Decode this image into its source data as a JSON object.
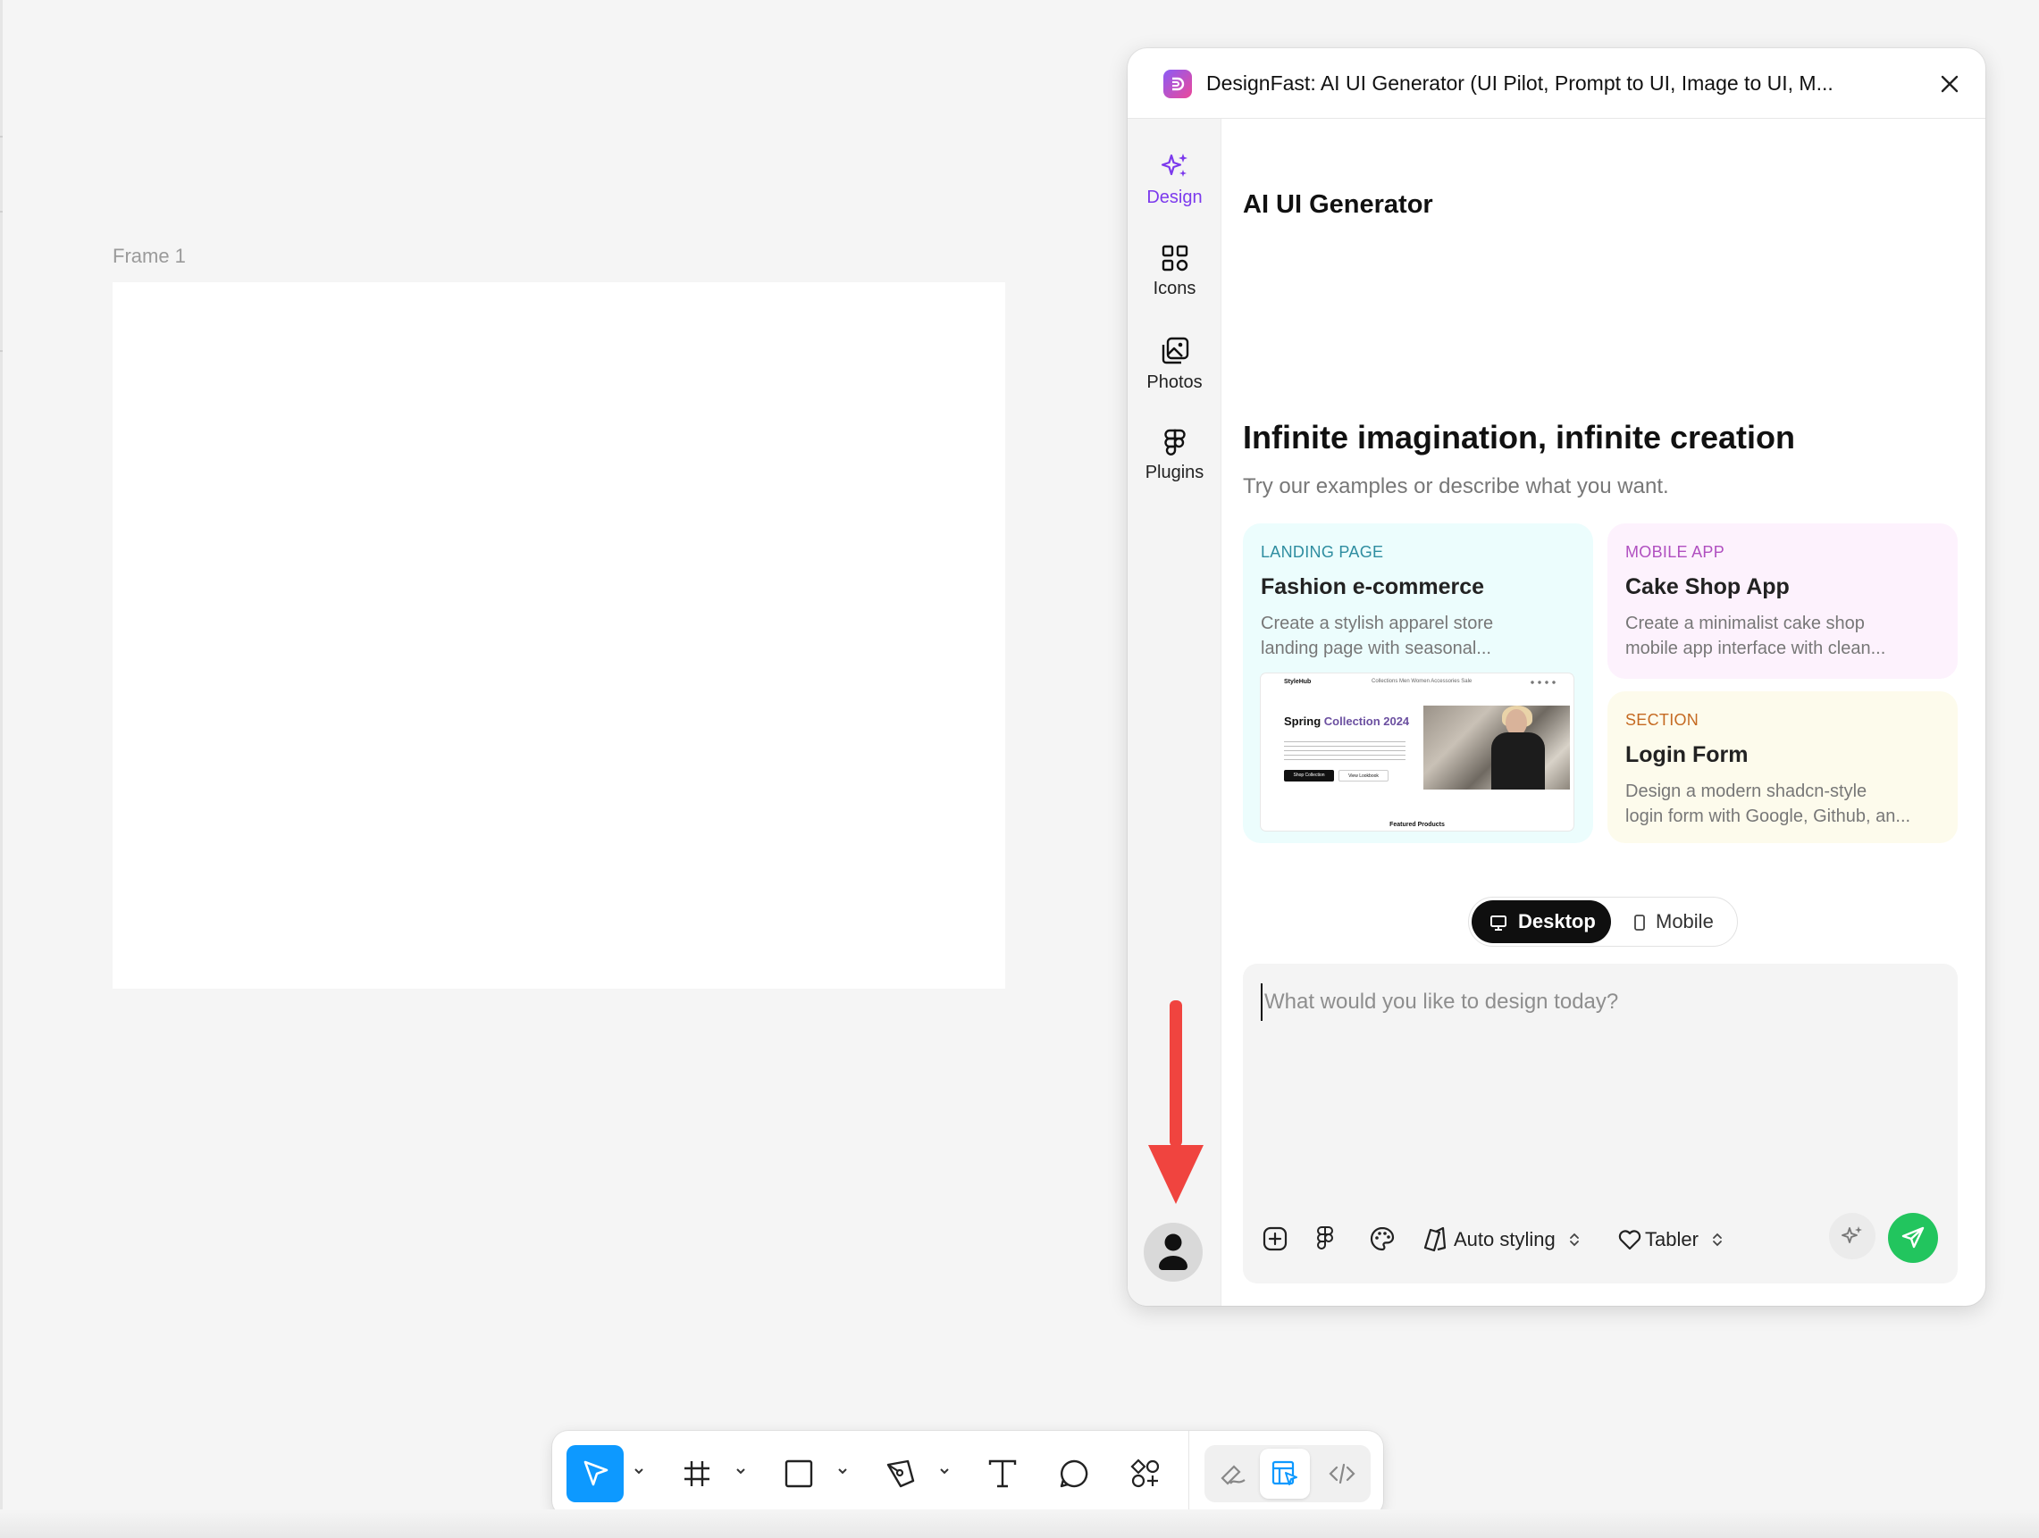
{
  "canvas": {
    "frame_label": "Frame 1"
  },
  "panel": {
    "title": "DesignFast: AI UI Generator (UI Pilot, Prompt to UI, Image to UI, M...",
    "nav": [
      {
        "label": "Design",
        "icon": "sparkles-icon",
        "active": true
      },
      {
        "label": "Icons",
        "icon": "grid-icon"
      },
      {
        "label": "Photos",
        "icon": "photos-icon"
      },
      {
        "label": "Plugins",
        "icon": "figma-icon"
      }
    ],
    "heading": "AI UI Generator",
    "hero_title": "Infinite imagination, infinite creation",
    "hero_subtitle": "Try our examples or describe what you want.",
    "examples": [
      {
        "tag": "LANDING PAGE",
        "title": "Fashion e-commerce",
        "desc_line1": "Create a stylish apparel store",
        "desc_line2": "landing page with seasonal..."
      },
      {
        "tag": "MOBILE APP",
        "title": "Cake Shop App",
        "desc_line1": "Create a minimalist cake shop",
        "desc_line2": "mobile app interface with clean..."
      },
      {
        "tag": "SECTION",
        "title": "Login Form",
        "desc_line1": "Design a modern shadcn-style",
        "desc_line2": "login form with Google, Github, an..."
      }
    ],
    "preview": {
      "brand": "StyleHub",
      "nav": "Collections   Men   Women   Accessories   Sale",
      "headline_a": "Spring",
      "headline_b": "Collection 2024",
      "btn1": "Shop Collection",
      "btn2": "View Lookbook",
      "featured": "Featured Products"
    },
    "device_toggle": {
      "desktop": "Desktop",
      "mobile": "Mobile",
      "selected": "Desktop"
    },
    "prompt": {
      "placeholder": "What would you like to design today?",
      "value": "",
      "style_label": "Auto styling",
      "kit_label": "Tabler"
    }
  },
  "colors": {
    "accent_purple": "#7c3aed",
    "send_green": "#22c55e",
    "tool_blue": "#0d99ff",
    "annotation_arrow": "#f0443f"
  },
  "toolbar": {
    "tools": [
      "move-tool",
      "frame-tool",
      "rectangle-tool",
      "pen-tool",
      "text-tool",
      "comment-tool",
      "actions-tool"
    ],
    "modes": [
      "draw-mode",
      "design-mode",
      "dev-mode"
    ],
    "active_tool": "move-tool",
    "active_mode": "design-mode"
  }
}
